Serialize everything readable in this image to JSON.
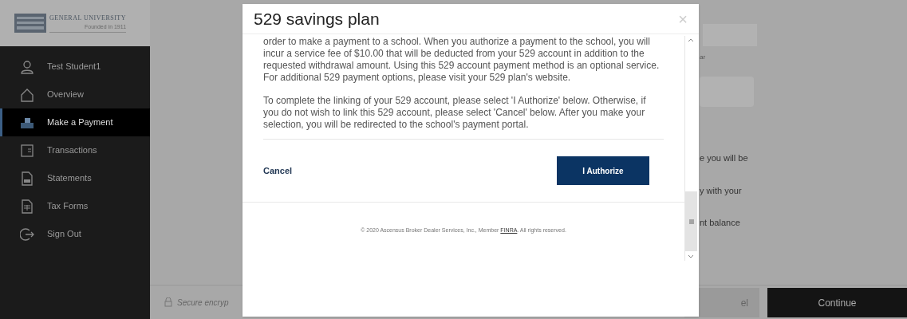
{
  "sidebar": {
    "logo": {
      "name": "GENERAL UNIVERSITY",
      "tagline": "Founded in 1911"
    },
    "items": [
      {
        "kind": "user",
        "label": "Test Student1",
        "selected": false
      },
      {
        "kind": "home",
        "label": "Overview",
        "selected": false
      },
      {
        "kind": "payment",
        "label": "Make a Payment",
        "selected": true
      },
      {
        "kind": "transactions",
        "label": "Transactions",
        "selected": false
      },
      {
        "kind": "statements",
        "label": "Statements",
        "selected": false
      },
      {
        "kind": "taxforms",
        "label": "Tax Forms",
        "selected": false
      },
      {
        "kind": "signout",
        "label": "Sign Out",
        "selected": false
      }
    ]
  },
  "background": {
    "fragment_top": "ar",
    "lines": [
      "e you will be",
      "y with your",
      "nt balance"
    ],
    "secure_text": "Secure encryp",
    "cancel_fragment": "el",
    "continue": "Continue"
  },
  "modal": {
    "title": "529 savings plan",
    "close": "×",
    "paragraphs": [
      "order to make a payment to a school. When you authorize a payment to the school, you will incur a service fee of $10.00 that will be deducted from your 529 account in addition to the requested withdrawal amount. Using this 529 account payment method is an optional service. For additional 529 payment options, please visit your 529 plan's website.",
      "To complete the linking of your 529 account, please select 'I Authorize' below. Otherwise, if you do not wish to link this 529 account, please select 'Cancel' below. After you make your selection, you will be redirected to the school's payment portal."
    ],
    "cancel": "Cancel",
    "authorize": "I Authorize",
    "copyright": {
      "before": "© 2020 Ascensus Broker Dealer Services, Inc., Member",
      "link": "FINRA",
      "after": ". All rights reserved."
    }
  }
}
